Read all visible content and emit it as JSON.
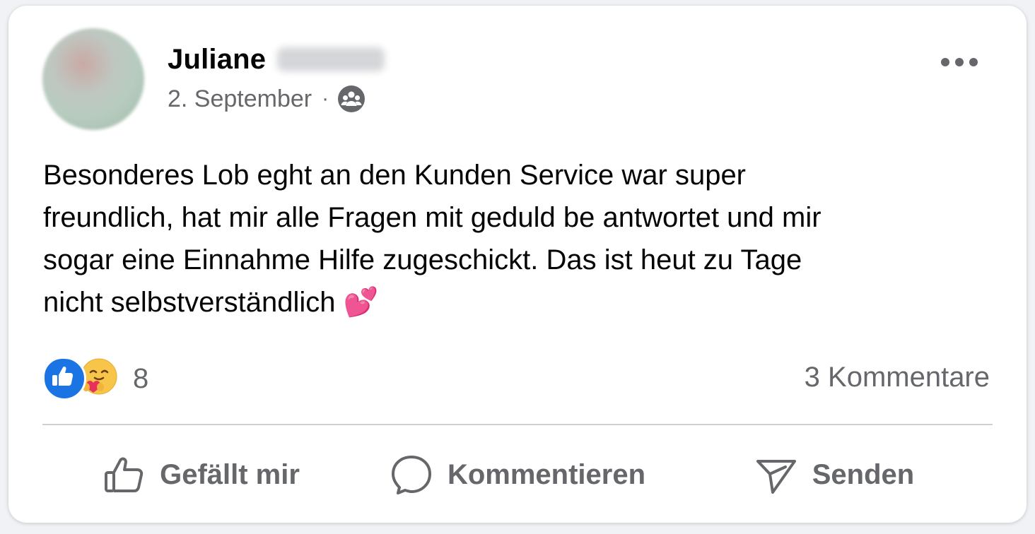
{
  "post": {
    "author_name": "Juliane",
    "date": "2. September",
    "separator": "·",
    "audience_icon": "group-icon",
    "text": "Besonderes Lob eght an den Kunden Service war super\nfreundlich, hat mir alle Fragen mit geduld be antwortet und mir\nsogar eine Einnahme Hilfe zugeschickt. Das ist heut zu Tage\nnicht selbstverständlich 💕",
    "reactions": {
      "icons": [
        "like-reaction-icon",
        "care-reaction-icon"
      ],
      "count": "8"
    },
    "comments_label": "3 Kommentare"
  },
  "actions": {
    "like_label": "Gefällt mir",
    "comment_label": "Kommentieren",
    "send_label": "Senden"
  },
  "colors": {
    "text_primary": "#050505",
    "text_secondary": "#65676b",
    "like_blue": "#1b74e4",
    "divider": "#ced0d4"
  }
}
